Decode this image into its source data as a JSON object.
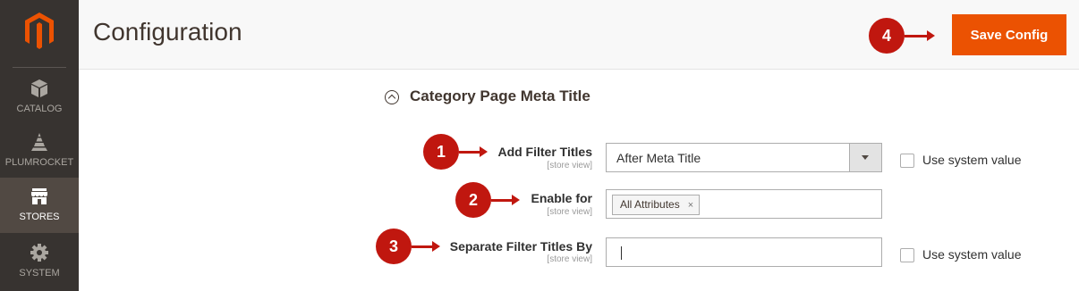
{
  "sidebar": {
    "logo_icon": "magento-logo-icon",
    "items": [
      {
        "label": "CATALOG",
        "icon": "box-icon",
        "active": false
      },
      {
        "label": "PLUMROCKET",
        "icon": "rocket-icon",
        "active": false
      },
      {
        "label": "STORES",
        "icon": "store-icon",
        "active": true
      },
      {
        "label": "SYSTEM",
        "icon": "gear-icon",
        "active": false
      }
    ]
  },
  "header": {
    "title": "Configuration",
    "save_label": "Save Config"
  },
  "section": {
    "title": "Category Page Meta Title",
    "icon": "collapse-icon"
  },
  "fields": {
    "add_filter_titles": {
      "label": "Add Filter Titles",
      "scope": "[store view]",
      "value": "After Meta Title",
      "use_system_label": "Use system value"
    },
    "enable_for": {
      "label": "Enable for",
      "scope": "[store view]",
      "chip": "All Attributes",
      "chip_remove": "×"
    },
    "separate_by": {
      "label": "Separate Filter Titles By",
      "scope": "[store view]",
      "value": "",
      "use_system_label": "Use system value"
    }
  },
  "annotations": {
    "markers": [
      "1",
      "2",
      "3",
      "4"
    ],
    "color": "#c0170f"
  },
  "colors": {
    "accent": "#eb5202",
    "sidebar_bg": "#373330",
    "sidebar_active": "#514943"
  }
}
